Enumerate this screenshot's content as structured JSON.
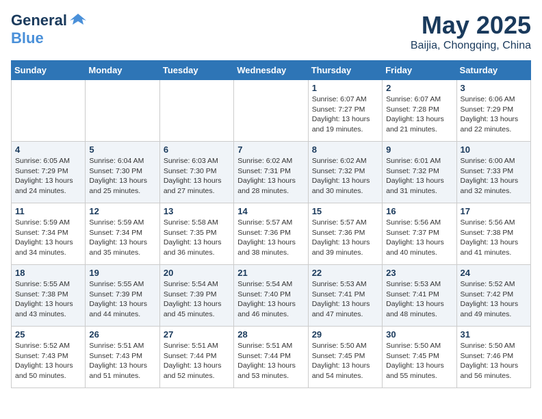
{
  "header": {
    "logo_line1": "General",
    "logo_line2": "Blue",
    "month": "May 2025",
    "location": "Baijia, Chongqing, China"
  },
  "weekdays": [
    "Sunday",
    "Monday",
    "Tuesday",
    "Wednesday",
    "Thursday",
    "Friday",
    "Saturday"
  ],
  "weeks": [
    [
      {
        "day": "",
        "info": ""
      },
      {
        "day": "",
        "info": ""
      },
      {
        "day": "",
        "info": ""
      },
      {
        "day": "",
        "info": ""
      },
      {
        "day": "1",
        "info": "Sunrise: 6:07 AM\nSunset: 7:27 PM\nDaylight: 13 hours\nand 19 minutes."
      },
      {
        "day": "2",
        "info": "Sunrise: 6:07 AM\nSunset: 7:28 PM\nDaylight: 13 hours\nand 21 minutes."
      },
      {
        "day": "3",
        "info": "Sunrise: 6:06 AM\nSunset: 7:29 PM\nDaylight: 13 hours\nand 22 minutes."
      }
    ],
    [
      {
        "day": "4",
        "info": "Sunrise: 6:05 AM\nSunset: 7:29 PM\nDaylight: 13 hours\nand 24 minutes."
      },
      {
        "day": "5",
        "info": "Sunrise: 6:04 AM\nSunset: 7:30 PM\nDaylight: 13 hours\nand 25 minutes."
      },
      {
        "day": "6",
        "info": "Sunrise: 6:03 AM\nSunset: 7:30 PM\nDaylight: 13 hours\nand 27 minutes."
      },
      {
        "day": "7",
        "info": "Sunrise: 6:02 AM\nSunset: 7:31 PM\nDaylight: 13 hours\nand 28 minutes."
      },
      {
        "day": "8",
        "info": "Sunrise: 6:02 AM\nSunset: 7:32 PM\nDaylight: 13 hours\nand 30 minutes."
      },
      {
        "day": "9",
        "info": "Sunrise: 6:01 AM\nSunset: 7:32 PM\nDaylight: 13 hours\nand 31 minutes."
      },
      {
        "day": "10",
        "info": "Sunrise: 6:00 AM\nSunset: 7:33 PM\nDaylight: 13 hours\nand 32 minutes."
      }
    ],
    [
      {
        "day": "11",
        "info": "Sunrise: 5:59 AM\nSunset: 7:34 PM\nDaylight: 13 hours\nand 34 minutes."
      },
      {
        "day": "12",
        "info": "Sunrise: 5:59 AM\nSunset: 7:34 PM\nDaylight: 13 hours\nand 35 minutes."
      },
      {
        "day": "13",
        "info": "Sunrise: 5:58 AM\nSunset: 7:35 PM\nDaylight: 13 hours\nand 36 minutes."
      },
      {
        "day": "14",
        "info": "Sunrise: 5:57 AM\nSunset: 7:36 PM\nDaylight: 13 hours\nand 38 minutes."
      },
      {
        "day": "15",
        "info": "Sunrise: 5:57 AM\nSunset: 7:36 PM\nDaylight: 13 hours\nand 39 minutes."
      },
      {
        "day": "16",
        "info": "Sunrise: 5:56 AM\nSunset: 7:37 PM\nDaylight: 13 hours\nand 40 minutes."
      },
      {
        "day": "17",
        "info": "Sunrise: 5:56 AM\nSunset: 7:38 PM\nDaylight: 13 hours\nand 41 minutes."
      }
    ],
    [
      {
        "day": "18",
        "info": "Sunrise: 5:55 AM\nSunset: 7:38 PM\nDaylight: 13 hours\nand 43 minutes."
      },
      {
        "day": "19",
        "info": "Sunrise: 5:55 AM\nSunset: 7:39 PM\nDaylight: 13 hours\nand 44 minutes."
      },
      {
        "day": "20",
        "info": "Sunrise: 5:54 AM\nSunset: 7:39 PM\nDaylight: 13 hours\nand 45 minutes."
      },
      {
        "day": "21",
        "info": "Sunrise: 5:54 AM\nSunset: 7:40 PM\nDaylight: 13 hours\nand 46 minutes."
      },
      {
        "day": "22",
        "info": "Sunrise: 5:53 AM\nSunset: 7:41 PM\nDaylight: 13 hours\nand 47 minutes."
      },
      {
        "day": "23",
        "info": "Sunrise: 5:53 AM\nSunset: 7:41 PM\nDaylight: 13 hours\nand 48 minutes."
      },
      {
        "day": "24",
        "info": "Sunrise: 5:52 AM\nSunset: 7:42 PM\nDaylight: 13 hours\nand 49 minutes."
      }
    ],
    [
      {
        "day": "25",
        "info": "Sunrise: 5:52 AM\nSunset: 7:43 PM\nDaylight: 13 hours\nand 50 minutes."
      },
      {
        "day": "26",
        "info": "Sunrise: 5:51 AM\nSunset: 7:43 PM\nDaylight: 13 hours\nand 51 minutes."
      },
      {
        "day": "27",
        "info": "Sunrise: 5:51 AM\nSunset: 7:44 PM\nDaylight: 13 hours\nand 52 minutes."
      },
      {
        "day": "28",
        "info": "Sunrise: 5:51 AM\nSunset: 7:44 PM\nDaylight: 13 hours\nand 53 minutes."
      },
      {
        "day": "29",
        "info": "Sunrise: 5:50 AM\nSunset: 7:45 PM\nDaylight: 13 hours\nand 54 minutes."
      },
      {
        "day": "30",
        "info": "Sunrise: 5:50 AM\nSunset: 7:45 PM\nDaylight: 13 hours\nand 55 minutes."
      },
      {
        "day": "31",
        "info": "Sunrise: 5:50 AM\nSunset: 7:46 PM\nDaylight: 13 hours\nand 56 minutes."
      }
    ]
  ]
}
